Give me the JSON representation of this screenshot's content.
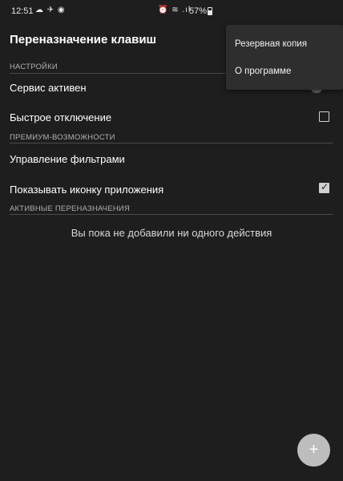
{
  "status_bar": {
    "time": "12:51",
    "left_icons": "☁ ✈ ◉",
    "right_icons": "⏰ ≋ .ıl",
    "battery": "57%"
  },
  "app": {
    "title": "Переназначение клавиш"
  },
  "sections": {
    "settings": "НАСТРОЙКИ",
    "premium": "ПРЕМИУМ-ВОЗМОЖНОСТИ",
    "active_remaps": "АКТИВНЫЕ ПЕРЕНАЗНАЧЕНИЯ"
  },
  "settings": {
    "service_active": "Сервис активен",
    "quick_disable": "Быстрое отключение",
    "quick_disable_checked": false
  },
  "premium": {
    "manage_filters": "Управление фильтрами",
    "show_app_icon": "Показывать иконку приложения",
    "show_app_icon_checked": true
  },
  "remaps": {
    "empty_text": "Вы пока не добавили ни одного действия"
  },
  "menu": {
    "items": [
      "Резервная копия",
      "О программе"
    ]
  },
  "fab": {
    "label": "+"
  },
  "icons": {
    "check": "✓"
  }
}
